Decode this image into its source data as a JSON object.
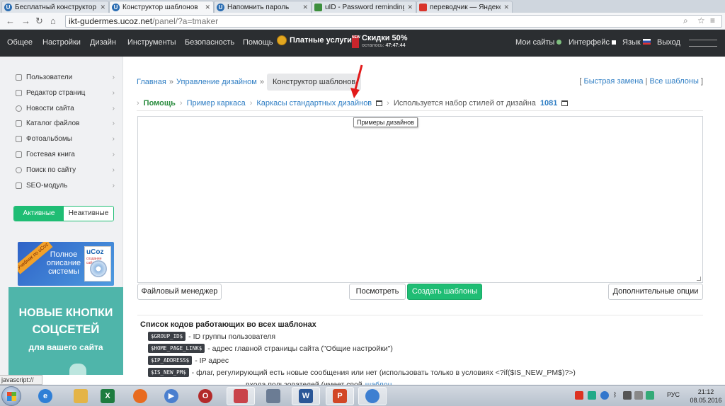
{
  "browser": {
    "tabs": [
      {
        "label": "Бесплатный конструктор"
      },
      {
        "label": "Конструктор шаблонов"
      },
      {
        "label": "Напомнить пароль"
      },
      {
        "label": "uID - Password reminding"
      },
      {
        "label": "переводчик — Яндекс.н"
      }
    ],
    "url_host": "ikt-gudermes.ucoz.net",
    "url_path": "/panel/?a=tmaker"
  },
  "topnav": {
    "items": [
      "Общее",
      "Настройки",
      "Дизайн",
      "Инструменты",
      "Безопасность",
      "Помощь"
    ],
    "paid": "Платные услуги",
    "discount_title": "Скидки 50%",
    "discount_left": "осталось:",
    "discount_time": "47:47:44",
    "gift_text": "NEW",
    "my_sites": "Мои сайты",
    "interface": "Интерфейс",
    "language": "Язык",
    "exit": "Выход"
  },
  "sidebar": {
    "items": [
      "Пользователи",
      "Редактор страниц",
      "Новости сайта",
      "Каталог файлов",
      "Фотоальбомы",
      "Гостевая книга",
      "Поиск по сайту",
      "SEO-модуль"
    ],
    "toggle_active": "Активные",
    "toggle_inactive": "Неактивные",
    "banner1": {
      "ribbon": "Учебник по uCoz",
      "text": "Полное описание системы",
      "box_title": "uCoz",
      "box_sub": "создание сайтов"
    },
    "banner2": {
      "line1": "НОВЫЕ КНОПКИ",
      "line2": "СОЦСЕТЕЙ",
      "line3": "для вашего сайта"
    }
  },
  "main": {
    "breadcrumb": {
      "home": "Главная",
      "design": "Управление дизайном",
      "current": "Конструктор шаблонов",
      "sep": "»"
    },
    "quick": {
      "open": "[",
      "replace": "Быстрая замена",
      "pipe": "|",
      "all": "Все шаблоны",
      "close": "]"
    },
    "help_row": {
      "help": "Помощь",
      "sample": "Пример каркаса",
      "frames": "Каркасы стандартных дизайнов",
      "using": "Используется набор стилей от дизайна",
      "design_num": "1081"
    },
    "tooltip": "Примеры дизайнов",
    "buttons": {
      "file_manager": "Файловый менеджер",
      "preview": "Посмотреть",
      "create": "Создать шаблоны",
      "extra": "Дополнительные опции"
    },
    "codes": {
      "title": "Список кодов работающих во всех шаблонах",
      "rows": [
        {
          "code": "$GROUP_ID$",
          "desc": "- ID группы пользователя"
        },
        {
          "code": "$HOME_PAGE_LINK$",
          "desc": "- адрес главной страницы сайта (\"Общие настройки\")"
        },
        {
          "code": "$IP_ADDRESS$",
          "desc": "- IP адрес"
        },
        {
          "code": "$IS_NEW_PM$",
          "desc": "- флаг, регулирующий есть новые сообщения или нет (использовать только в условиях <?if($IS_NEW_PM$)?>)"
        }
      ],
      "partial": "входа пользователей (имеет свой",
      "partial_link": "шаблон"
    }
  },
  "status": {
    "text": "javascript://"
  },
  "taskbar": {
    "lang": "РУС",
    "time": "21:12",
    "date": "08.05.2016"
  },
  "colors": {
    "accent": "#1fbd74",
    "link": "#2f7ec4",
    "topnav": "#2b2e31"
  }
}
